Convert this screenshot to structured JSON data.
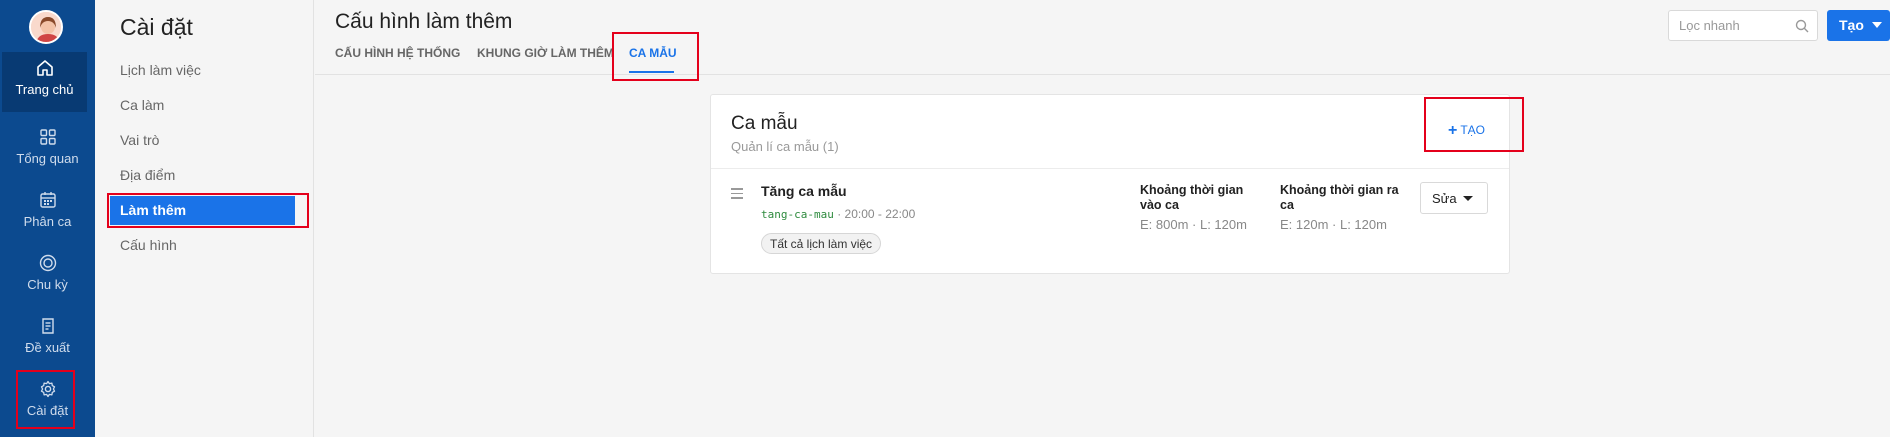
{
  "rail": {
    "items": [
      {
        "label": "Trang chủ",
        "icon": "home-icon"
      },
      {
        "label": "Tổng quan",
        "icon": "grid-icon"
      },
      {
        "label": "Phân ca",
        "icon": "calendar-icon"
      },
      {
        "label": "Chu kỳ",
        "icon": "cycle-icon"
      },
      {
        "label": "Đề xuất",
        "icon": "document-icon"
      },
      {
        "label": "Cài đặt",
        "icon": "gear-icon"
      }
    ]
  },
  "submenu": {
    "title": "Cài đặt",
    "items": [
      {
        "label": "Lịch làm việc"
      },
      {
        "label": "Ca làm"
      },
      {
        "label": "Vai trò"
      },
      {
        "label": "Địa điểm"
      },
      {
        "label": "Làm thêm"
      },
      {
        "label": "Cấu hình"
      }
    ]
  },
  "header": {
    "title": "Cấu hình làm thêm",
    "tabs": [
      {
        "label": "CẤU HÌNH HỆ THỐNG"
      },
      {
        "label": "KHUNG GIỜ LÀM THÊM"
      },
      {
        "label": "CA MẪU"
      }
    ],
    "search_placeholder": "Lọc nhanh",
    "create_label": "Tạo"
  },
  "card": {
    "title": "Ca mẫu",
    "subtitle": "Quản lí ca mẫu (1)",
    "add_label": "TẠO",
    "item": {
      "name": "Tăng ca mẫu",
      "code": "tang-ca-mau",
      "time": "· 20:00 - 22:00",
      "tag": "Tất cả lịch làm việc",
      "checkin_head": "Khoảng thời gian vào ca",
      "checkin_value": "E: 800m · L: 120m",
      "checkout_head": "Khoảng thời gian ra ca",
      "checkout_value": "E: 120m · L: 120m",
      "edit_label": "Sửa"
    }
  },
  "colors": {
    "rail_bg": "#0c4a8f",
    "accent": "#1a73e8",
    "highlight": "#e4001b"
  }
}
